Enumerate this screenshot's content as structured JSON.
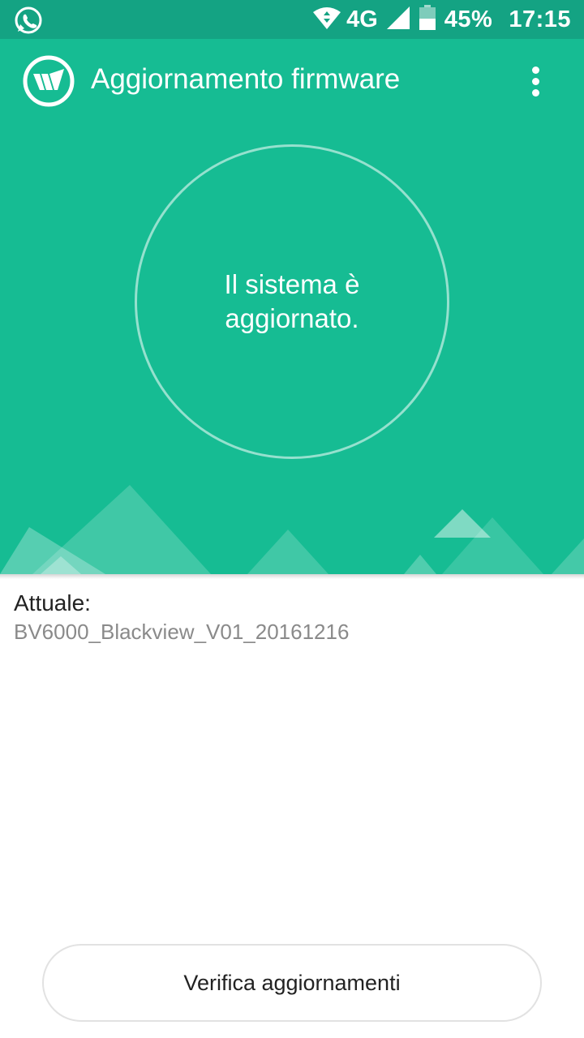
{
  "status_bar": {
    "battery": "45%",
    "time": "17:15",
    "network": "4G",
    "icons": [
      "whatsapp-icon",
      "wifi-icon",
      "signal-icon",
      "battery-icon"
    ]
  },
  "toolbar": {
    "title": "Aggiornamento firmware",
    "menu_icon": "more-vert-icon"
  },
  "status": {
    "message": "Il sistema è aggiornato."
  },
  "firmware": {
    "current_label": "Attuale:",
    "current_version": "BV6000_Blackview_V01_20161216"
  },
  "actions": {
    "check_label": "Verifica aggiornamenti"
  },
  "colors": {
    "accent": "#16bc93",
    "status_bar": "#14a383"
  }
}
